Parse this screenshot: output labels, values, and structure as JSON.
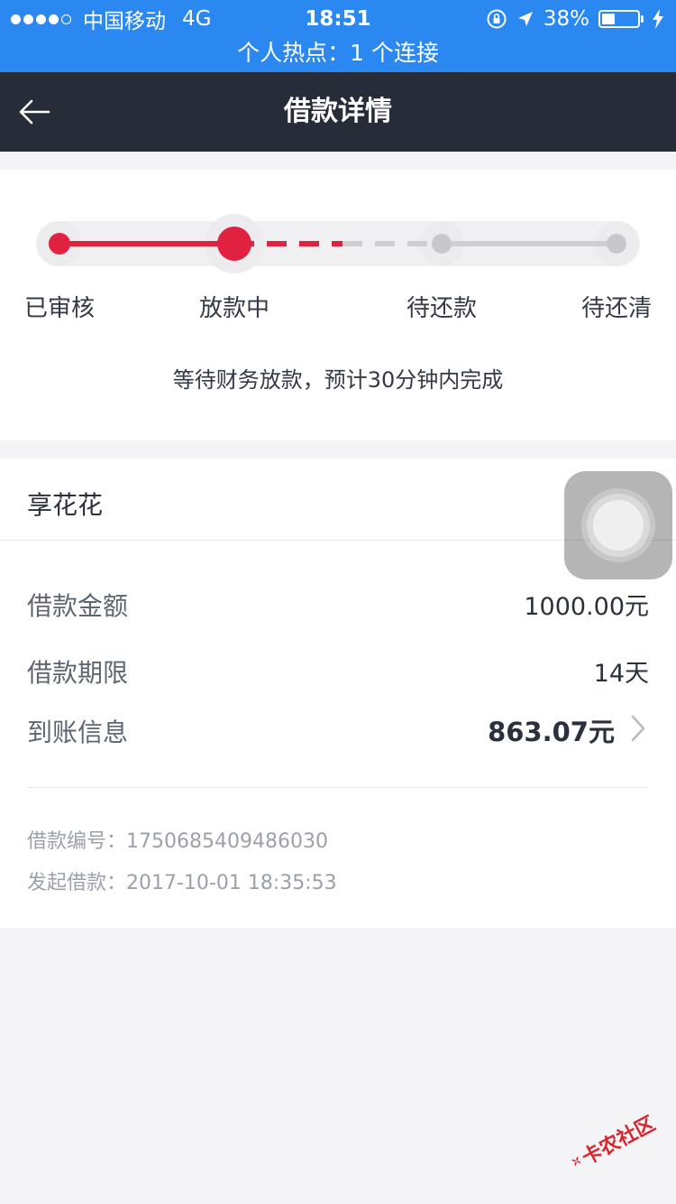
{
  "status_bar": {
    "carrier": "中国移动",
    "network": "4G",
    "time": "18:51",
    "battery": "38%",
    "hotspot_text": "个人热点：1 个连接"
  },
  "nav": {
    "title": "借款详情",
    "back_icon": "arrow-left-icon"
  },
  "progress": {
    "steps": [
      "已审核",
      "放款中",
      "待还款",
      "待还清"
    ],
    "current_step": 2,
    "note": "等待财务放款，预计30分钟内完成",
    "active_color": "#e0213f",
    "inactive_color": "#c8c8cc"
  },
  "detail": {
    "product_name": "享花花",
    "rows": [
      {
        "label": "借款金额",
        "value": "1000.00元"
      },
      {
        "label": "借款期限",
        "value": "14天"
      },
      {
        "label": "到账信息",
        "value": "863.07元"
      }
    ],
    "loan_number": "借款编号：1750685409486030",
    "initiated": "发起借款：2017-10-01 18:35:53"
  },
  "watermark": {
    "text": "卡农社区"
  }
}
